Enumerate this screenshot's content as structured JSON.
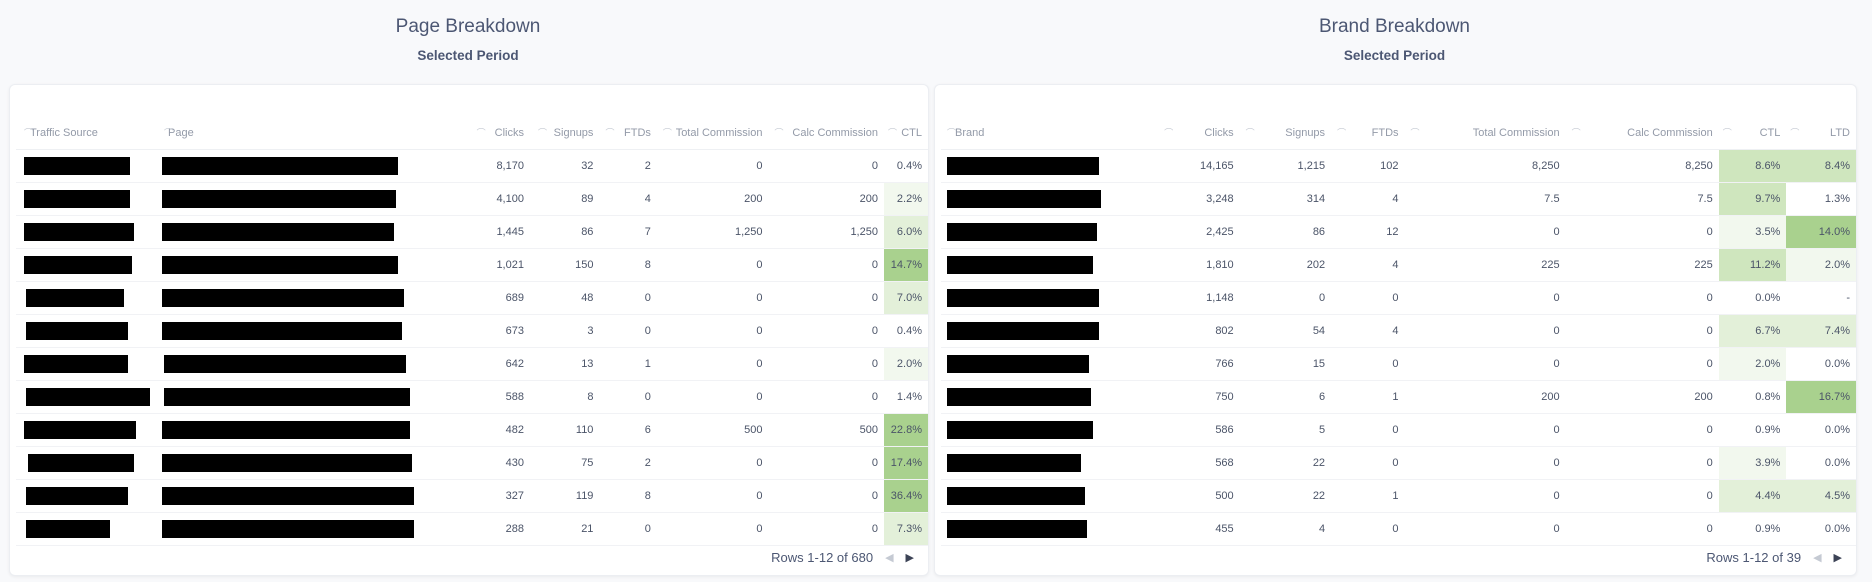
{
  "page_panel": {
    "title": "Page Breakdown",
    "subtitle": "Selected Period",
    "columns": [
      "Traffic Source",
      "Page",
      "Clicks",
      "Signups",
      "FTDs",
      "Total Commission",
      "Calc Commission",
      "CTL"
    ],
    "rows": [
      {
        "clicks": "8,170",
        "signups": "32",
        "ftds": "2",
        "total": "0",
        "calc": "0",
        "ctl": "0.4%"
      },
      {
        "clicks": "4,100",
        "signups": "89",
        "ftds": "4",
        "total": "200",
        "calc": "200",
        "ctl": "2.2%"
      },
      {
        "clicks": "1,445",
        "signups": "86",
        "ftds": "7",
        "total": "1,250",
        "calc": "1,250",
        "ctl": "6.0%"
      },
      {
        "clicks": "1,021",
        "signups": "150",
        "ftds": "8",
        "total": "0",
        "calc": "0",
        "ctl": "14.7%"
      },
      {
        "clicks": "689",
        "signups": "48",
        "ftds": "0",
        "total": "0",
        "calc": "0",
        "ctl": "7.0%"
      },
      {
        "clicks": "673",
        "signups": "3",
        "ftds": "0",
        "total": "0",
        "calc": "0",
        "ctl": "0.4%"
      },
      {
        "clicks": "642",
        "signups": "13",
        "ftds": "1",
        "total": "0",
        "calc": "0",
        "ctl": "2.0%"
      },
      {
        "clicks": "588",
        "signups": "8",
        "ftds": "0",
        "total": "0",
        "calc": "0",
        "ctl": "1.4%"
      },
      {
        "clicks": "482",
        "signups": "110",
        "ftds": "6",
        "total": "500",
        "calc": "500",
        "ctl": "22.8%"
      },
      {
        "clicks": "430",
        "signups": "75",
        "ftds": "2",
        "total": "0",
        "calc": "0",
        "ctl": "17.4%"
      },
      {
        "clicks": "327",
        "signups": "119",
        "ftds": "8",
        "total": "0",
        "calc": "0",
        "ctl": "36.4%"
      },
      {
        "clicks": "288",
        "signups": "21",
        "ftds": "0",
        "total": "0",
        "calc": "0",
        "ctl": "7.3%"
      }
    ],
    "footer": "Rows 1-12 of 680"
  },
  "brand_panel": {
    "title": "Brand Breakdown",
    "subtitle": "Selected Period",
    "columns": [
      "Brand",
      "Clicks",
      "Signups",
      "FTDs",
      "Total Commission",
      "Calc Commission",
      "CTL",
      "LTD"
    ],
    "rows": [
      {
        "clicks": "14,165",
        "signups": "1,215",
        "ftds": "102",
        "total": "8,250",
        "calc": "8,250",
        "ctl": "8.6%",
        "ltd": "8.4%"
      },
      {
        "clicks": "3,248",
        "signups": "314",
        "ftds": "4",
        "total": "7.5",
        "calc": "7.5",
        "ctl": "9.7%",
        "ltd": "1.3%"
      },
      {
        "clicks": "2,425",
        "signups": "86",
        "ftds": "12",
        "total": "0",
        "calc": "0",
        "ctl": "3.5%",
        "ltd": "14.0%"
      },
      {
        "clicks": "1,810",
        "signups": "202",
        "ftds": "4",
        "total": "225",
        "calc": "225",
        "ctl": "11.2%",
        "ltd": "2.0%"
      },
      {
        "clicks": "1,148",
        "signups": "0",
        "ftds": "0",
        "total": "0",
        "calc": "0",
        "ctl": "0.0%",
        "ltd": "-"
      },
      {
        "clicks": "802",
        "signups": "54",
        "ftds": "4",
        "total": "0",
        "calc": "0",
        "ctl": "6.7%",
        "ltd": "7.4%"
      },
      {
        "clicks": "766",
        "signups": "15",
        "ftds": "0",
        "total": "0",
        "calc": "0",
        "ctl": "2.0%",
        "ltd": "0.0%"
      },
      {
        "clicks": "750",
        "signups": "6",
        "ftds": "1",
        "total": "200",
        "calc": "200",
        "ctl": "0.8%",
        "ltd": "16.7%"
      },
      {
        "clicks": "586",
        "signups": "5",
        "ftds": "0",
        "total": "0",
        "calc": "0",
        "ctl": "0.9%",
        "ltd": "0.0%"
      },
      {
        "clicks": "568",
        "signups": "22",
        "ftds": "0",
        "total": "0",
        "calc": "0",
        "ctl": "3.9%",
        "ltd": "0.0%"
      },
      {
        "clicks": "500",
        "signups": "22",
        "ftds": "1",
        "total": "0",
        "calc": "0",
        "ctl": "4.4%",
        "ltd": "4.5%"
      },
      {
        "clicks": "455",
        "signups": "4",
        "ftds": "0",
        "total": "0",
        "calc": "0",
        "ctl": "0.9%",
        "ltd": "0.0%"
      }
    ],
    "footer": "Rows 1-12 of 39"
  },
  "colors": {
    "heat_strong": "#a9d18e",
    "heat_mid": "#cfe6be",
    "heat_light": "#e3f0d9",
    "heat_faint": "#f2f8ee"
  }
}
